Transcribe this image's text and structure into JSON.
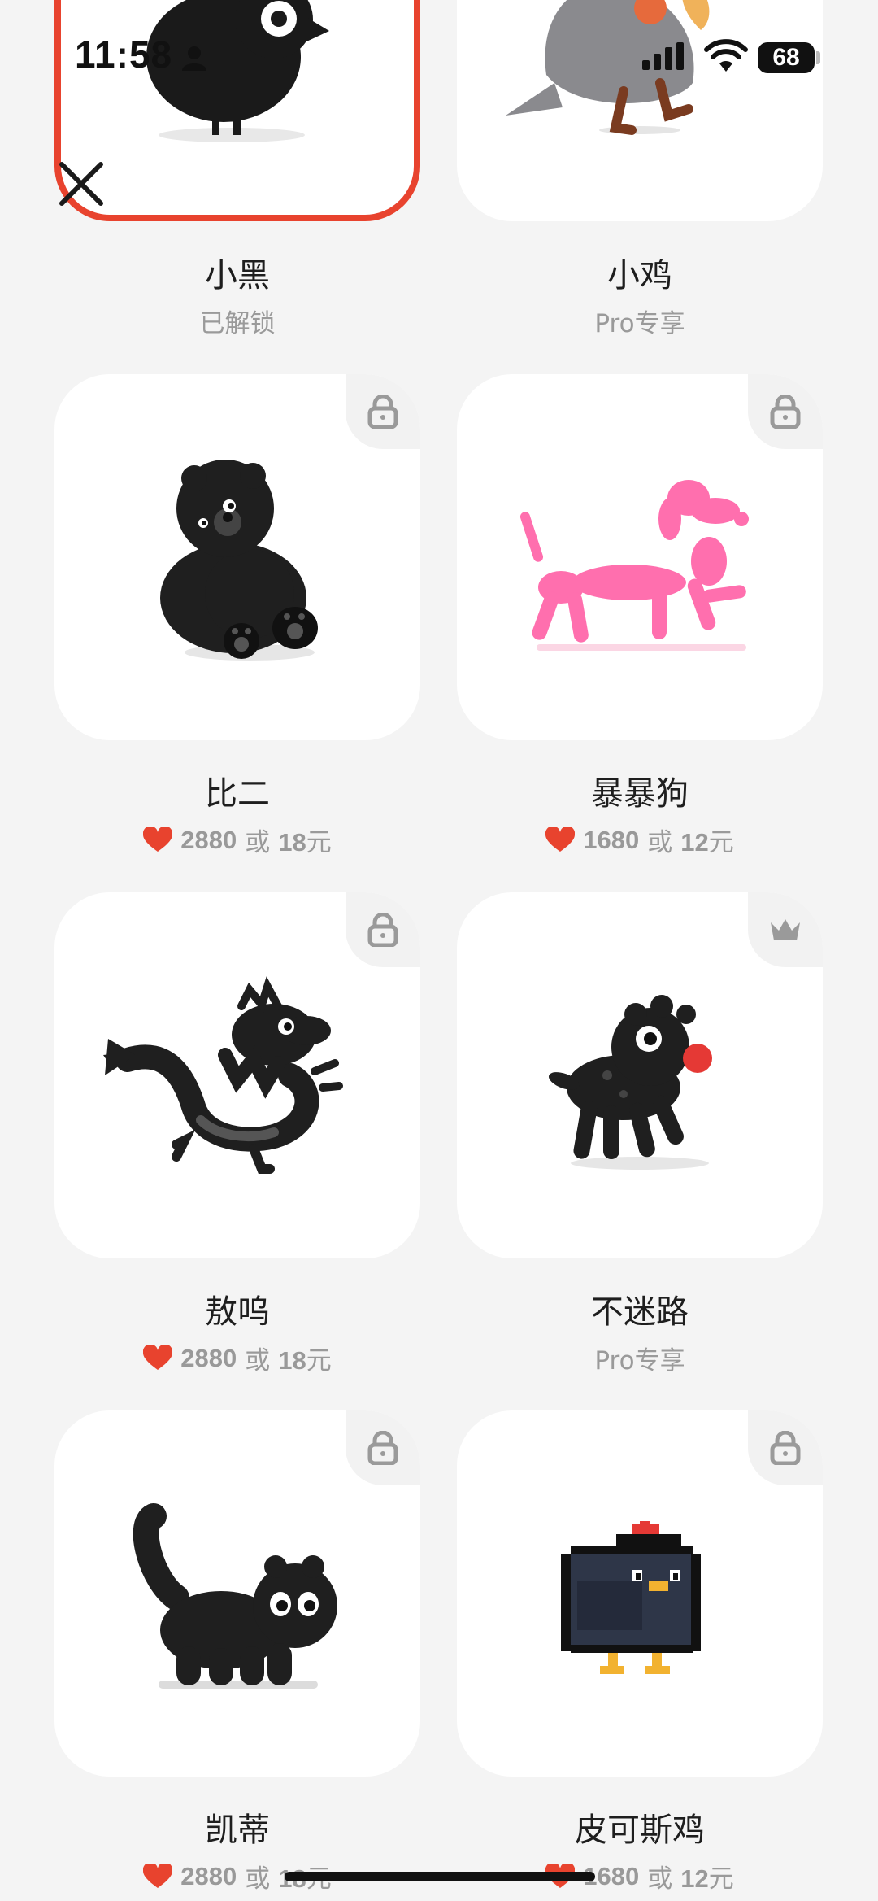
{
  "status_bar": {
    "time": "11:58",
    "battery": "68"
  },
  "items": [
    {
      "name": "小黑",
      "status": "已解锁"
    },
    {
      "name": "小鸡",
      "status": "Pro专享"
    },
    {
      "name": "比二",
      "hearts": "2880",
      "connector": "或",
      "price": "18",
      "currency": "元",
      "badge": "lock-icon"
    },
    {
      "name": "暴暴狗",
      "hearts": "1680",
      "connector": "或",
      "price": "12",
      "currency": "元",
      "badge": "lock-icon"
    },
    {
      "name": "敖呜",
      "hearts": "2880",
      "connector": "或",
      "price": "18",
      "currency": "元",
      "badge": "lock-icon"
    },
    {
      "name": "不迷路",
      "status": "Pro专享",
      "badge": "crown-icon"
    },
    {
      "name": "凯蒂",
      "hearts": "2880",
      "connector": "或",
      "price": "18",
      "currency": "元",
      "badge": "lock-icon"
    },
    {
      "name": "皮可斯鸡",
      "hearts": "1680",
      "connector": "或",
      "price": "12",
      "currency": "元",
      "badge": "lock-icon"
    }
  ],
  "colors": {
    "accent": "#e8432e",
    "heart": "#e8432e",
    "card_bg": "#ffffff",
    "page_bg": "#f4f4f4"
  }
}
